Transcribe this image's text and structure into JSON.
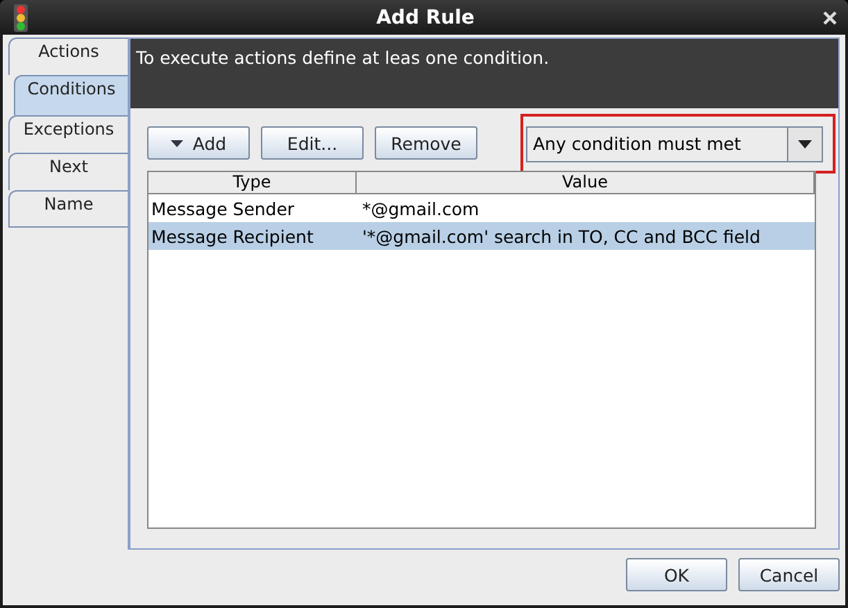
{
  "window": {
    "title": "Add Rule"
  },
  "tabs": [
    {
      "label": "Actions",
      "selected": false
    },
    {
      "label": "Conditions",
      "selected": true
    },
    {
      "label": "Exceptions",
      "selected": false
    },
    {
      "label": "Next",
      "selected": false
    },
    {
      "label": "Name",
      "selected": false
    }
  ],
  "info": "To execute actions define at leas one condition.",
  "toolbar": [
    {
      "label": "Add",
      "kind": "menu"
    },
    {
      "label": "Edit...",
      "kind": "plain"
    },
    {
      "label": "Remove",
      "kind": "plain"
    }
  ],
  "match_mode": {
    "value": "Any condition must met",
    "highlighted": true
  },
  "table": {
    "columns": [
      "Type",
      "Value"
    ],
    "rows": [
      {
        "cells": [
          "Message Sender",
          "*@gmail.com"
        ],
        "selected": false
      },
      {
        "cells": [
          "Message Recipient",
          "'*@gmail.com' search in TO, CC and BCC field"
        ],
        "selected": true
      }
    ]
  },
  "buttons": [
    "OK",
    "Cancel"
  ]
}
